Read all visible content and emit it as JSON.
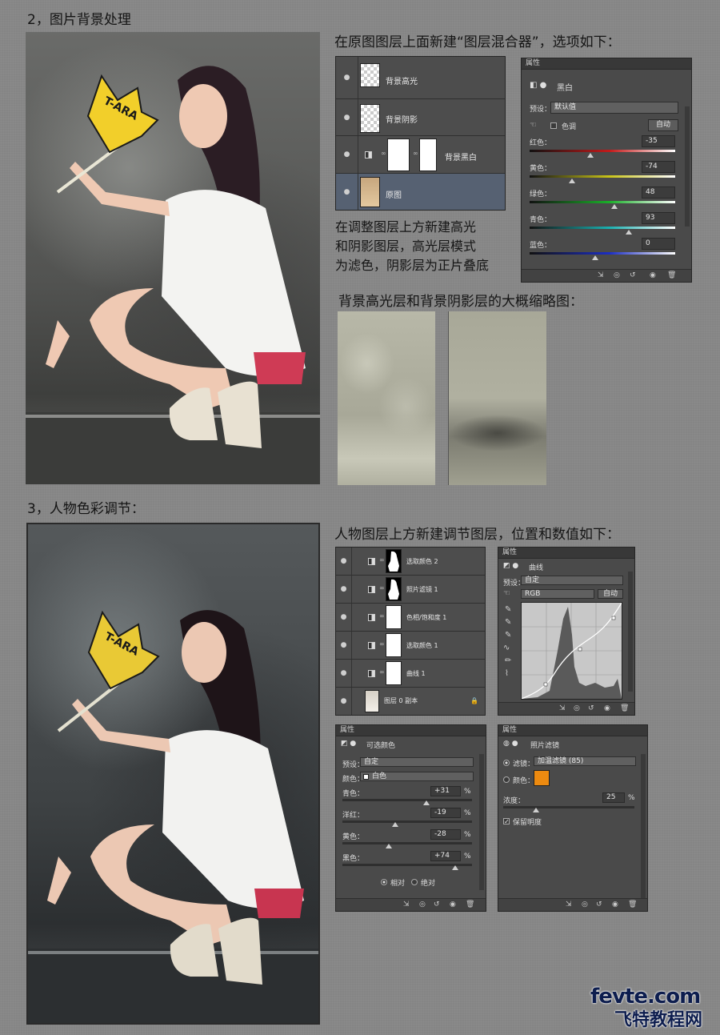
{
  "section2": {
    "heading": "2，图片背景处理",
    "instruction": "在原图图层上面新建“图层混合器”，选项如下：",
    "layers": [
      {
        "name": "背景高光",
        "type": "empty"
      },
      {
        "name": "背景阴影",
        "type": "empty"
      },
      {
        "name": "背景黑白",
        "type": "adjustment"
      },
      {
        "name": "原图",
        "type": "photo"
      }
    ],
    "note_lines": [
      "在调整图层上方新建高光",
      "和阴影图层，高光层模式",
      "为滤色，阴影层为正片叠底"
    ],
    "thumb_caption": "背景高光层和背景阴影层的大概缩略图：",
    "bw_panel": {
      "tab": "属性",
      "title": "黑白",
      "preset_label": "预设：",
      "preset_value": "默认值",
      "tint_label": "色调",
      "auto_label": "自动",
      "sliders": [
        {
          "label": "红色：",
          "value": "-35",
          "pos": 0.42,
          "color": "#c41a1a"
        },
        {
          "label": "黄色：",
          "value": "-74",
          "pos": 0.29,
          "color": "#c9c418"
        },
        {
          "label": "绿色：",
          "value": "48",
          "pos": 0.58,
          "color": "#1bb02a"
        },
        {
          "label": "青色：",
          "value": "93",
          "pos": 0.68,
          "color": "#1bb0b0"
        },
        {
          "label": "蓝色：",
          "value": "0",
          "pos": 0.45,
          "color": "#1c2ec4"
        }
      ]
    }
  },
  "section3": {
    "heading": "3，人物色彩调节：",
    "instruction": "人物图层上方新建调节图层，位置和数值如下：",
    "layers": [
      {
        "name": "选取颜色 2",
        "type": "sel-mask"
      },
      {
        "name": "照片滤镜 1",
        "type": "sel-mask"
      },
      {
        "name": "色相/饱和度 1",
        "type": "white"
      },
      {
        "name": "选取颜色 1",
        "type": "white"
      },
      {
        "name": "曲线 1",
        "type": "white"
      },
      {
        "name": "图层 0 副本",
        "type": "photo"
      }
    ],
    "curves_panel": {
      "tab": "属性",
      "title": "曲线",
      "preset_label": "预设：",
      "preset_value": "自定",
      "channel": "RGB",
      "auto_label": "自动"
    },
    "selective_panel": {
      "tab": "属性",
      "title": "可选颜色",
      "preset_label": "预设：",
      "preset_value": "自定",
      "color_label": "颜色：",
      "color_value": "白色",
      "percent": "%",
      "sliders": [
        {
          "label": "青色：",
          "value": "+31",
          "pos": 0.65
        },
        {
          "label": "洋红：",
          "value": "-19",
          "pos": 0.41
        },
        {
          "label": "黄色：",
          "value": "-28",
          "pos": 0.36
        },
        {
          "label": "黑色：",
          "value": "+74",
          "pos": 0.87
        }
      ],
      "relative_label": "相对",
      "absolute_label": "绝对"
    },
    "photo_filter_panel": {
      "tab": "属性",
      "title": "照片滤镜",
      "filter_label": "滤镜：",
      "filter_value": "加温滤镜 (85)",
      "color_label": "颜色：",
      "swatch_color": "#ec8a10",
      "density_label": "浓度：",
      "density_value": "25",
      "density_pos": 0.25,
      "percent": "%",
      "preserve_label": "保留明度"
    }
  },
  "watermark": {
    "line1": "fevte.com",
    "line2": "飞特教程网"
  },
  "photo_caption_text": "T-ARA"
}
